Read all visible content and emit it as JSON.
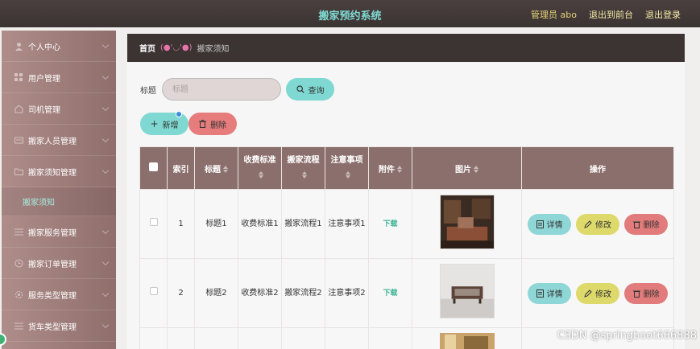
{
  "header": {
    "app_title": "搬家预约系统",
    "admin_label": "管理员 abo",
    "back_to_front": "退出到前台",
    "logout": "退出登录"
  },
  "sidebar": {
    "items": [
      {
        "label": "个人中心",
        "icon": "user-icon"
      },
      {
        "label": "用户管理",
        "icon": "grid-icon"
      },
      {
        "label": "司机管理",
        "icon": "home-icon"
      },
      {
        "label": "搬家人员管理",
        "icon": "card-icon"
      },
      {
        "label": "搬家须知管理",
        "icon": "folder-icon"
      },
      {
        "label": "搬家服务管理",
        "icon": "list-icon"
      },
      {
        "label": "搬家订单管理",
        "icon": "clock-icon"
      },
      {
        "label": "服务类型管理",
        "icon": "gear-icon"
      },
      {
        "label": "货车类型管理",
        "icon": "list-icon"
      }
    ],
    "active_sub": "搬家须知"
  },
  "breadcrumb": {
    "home": "首页",
    "emoticon": "(●'◡'●)",
    "current": "搬家须知"
  },
  "search": {
    "label": "标题",
    "placeholder": "标题",
    "query_button": "查询"
  },
  "toolbar": {
    "add_label": "新增",
    "delete_label": "删除"
  },
  "table": {
    "columns": [
      "索引",
      "标题",
      "收费标准",
      "搬家流程",
      "注意事项",
      "附件",
      "图片",
      "操作"
    ],
    "rows": [
      {
        "index": "1",
        "title": "标题1",
        "fee": "收费标准1",
        "process": "搬家流程1",
        "notes": "注意事项1",
        "attachment": "下载",
        "image": "interior-photo"
      },
      {
        "index": "2",
        "title": "标题2",
        "fee": "收费标准2",
        "process": "搬家流程2",
        "notes": "注意事项2",
        "attachment": "下载",
        "image": "furniture-photo"
      }
    ],
    "row_actions": {
      "detail": "详情",
      "edit": "修改",
      "delete": "删除"
    }
  },
  "watermark": "CSDN @springboot666888",
  "colors": {
    "accent_teal": "#7fd9d2",
    "header_bg": "#3b3332",
    "sidebar_bg": "#9e7e7b",
    "table_header": "#8b6f6d",
    "delete_red": "#e67c7c",
    "edit_yellow": "#ddd96a",
    "admin_yellow": "#e6d47a"
  }
}
